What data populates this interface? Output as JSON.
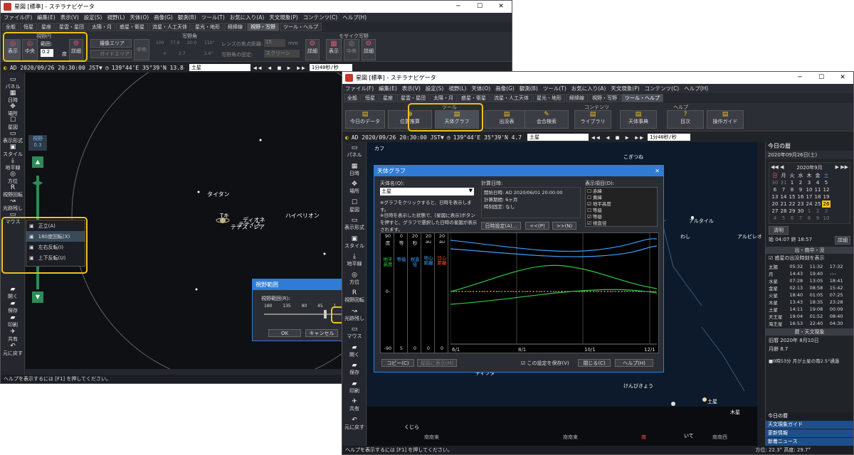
{
  "w1": {
    "title": "星図 [標準] - ステラナビゲータ",
    "menu": [
      "ファイル(F)",
      "編集(E)",
      "表示(V)",
      "設定(S)",
      "視野(L)",
      "天体(O)",
      "画像(G)",
      "観測(B)",
      "ツール(T)",
      "お気に入り(A)",
      "天文現象(P)",
      "コンテンツ(C)",
      "ヘルプ(H)"
    ],
    "tabs": [
      "全般",
      "恒星",
      "星座",
      "星雲・星団",
      "太陽・月",
      "惑星・衛星",
      "流星・人工天体",
      "星光・地形",
      "経緯線",
      "視野・写野",
      "ツール・ヘルプ"
    ],
    "grp_fov": "視野円",
    "grp_cam": "写野角",
    "grp_mosaic": "モザイク写野",
    "fov_show": "表示",
    "fov_center": "中央",
    "fov_range": "範囲:",
    "fov_value": "0.2",
    "fov_unit": "度",
    "fov_detail": "詳細",
    "cam_area": "撮像エリア",
    "cam_guide": "ガイドエリア",
    "cam_center": "中央",
    "cam_w": "100",
    "cam_h": "77.8",
    "cam_rot": "20.0",
    "cam_x": "×",
    "cam_h2": "2.7",
    "cam_deg": "110°",
    "cam_scale": "2.6°",
    "cam_rotlabel": "回転角",
    "cam_focus": "レンズの焦点距離:",
    "cam_focus_val": "15",
    "cam_mm": "mm",
    "cam_fix": "写野角の固定:",
    "cam_screen": "スクリーン",
    "cam_detail": "詳細",
    "mos_show": "表示",
    "mos_center": "中央",
    "mos_detail": "詳細",
    "status": "AD 2020/09/26 20:30:00 JST▼",
    "loc": "139°44'E 35°39'N 13.8",
    "target": "土星",
    "speed": "1分40秒/秒",
    "side": [
      "パネル",
      "日時",
      "場所",
      "星図",
      "表示形式",
      "スタイル",
      "地平線",
      "方位",
      "視野回転",
      "光跡残し",
      "マウス"
    ],
    "slider_label": "視野",
    "slider_val": "0.3",
    "planets": [
      "タイタン",
      "テティス",
      "ディオネ",
      "テチス・レア",
      "ハイペリオン",
      "Tキ"
    ],
    "rot_menu": [
      "正立(A)",
      "180度回転(X)",
      "左右反転(I)",
      "上下反転(U)"
    ],
    "fovdlg_title": "視野範囲",
    "fovdlg_label": "視野範囲(R):",
    "fovdlg_ticks": [
      "180",
      "135",
      "90",
      "45",
      "1",
      "0"
    ],
    "fovdlg_ok": "OK",
    "fovdlg_cancel": "キャンセル",
    "helptext": "ヘルプを表示するには [F1] を押してください。",
    "side_lower": [
      "開く",
      "保存",
      "印刷",
      "共有",
      "元に戻す"
    ]
  },
  "w2": {
    "title": "星図 [標準] - ステラナビゲータ",
    "menu": [
      "ファイル(F)",
      "編集(E)",
      "表示(V)",
      "設定(S)",
      "視野(L)",
      "天体(O)",
      "画像(G)",
      "観測(B)",
      "ツール(T)",
      "お気に入り(A)",
      "天文現象(P)",
      "コンテンツ(C)",
      "ヘルプ(H)"
    ],
    "tabs": [
      "全般",
      "恒星",
      "星座",
      "星雲・星団",
      "太陽・月",
      "惑星・衛星",
      "流星・人工天体",
      "星光・地形",
      "経緯線",
      "視野・写野",
      "ツール・ヘルプ"
    ],
    "grp_tool": "ツール",
    "grp_content": "コンテンツ",
    "grp_help": "ヘルプ",
    "buttons": [
      "今日のデータ",
      "位置推算",
      "天体グラフ",
      "出没表",
      "会合検索",
      "ライブラリ",
      "天体事典",
      "目次",
      "操作ガイド"
    ],
    "status": "AD 2020/09/26 20:30:00 JST▼",
    "loc": "139°44'E 35°39'N 4.7",
    "target": "土星",
    "speed": "1分40秒/秒",
    "side": [
      "パネル",
      "日時",
      "場所",
      "星図",
      "表示形式",
      "スタイル",
      "地平線",
      "方位",
      "視野回転",
      "光跡残し",
      "マウス",
      "開く",
      "保存",
      "印刷",
      "共有",
      "元に戻す"
    ],
    "sky_labels": [
      "カフ",
      "こぎつね",
      "アルタイル",
      "わし",
      "アルビレオ",
      "土星",
      "木星",
      "ディフダ",
      "いて",
      "けんびきょう",
      "くじら"
    ],
    "horizon": [
      "南南東",
      "南南東",
      "南",
      "南南西"
    ],
    "helptext": "ヘルプを表示するには [F1] を押してください。",
    "coords": "方位: 22.3° 高度: 29.7°"
  },
  "graph": {
    "title": "天体グラフ",
    "objlabel": "天体名(Q):",
    "objval": "土星",
    "note1": "※グラフをクリックすると、日時を表示します。",
    "note2": "※日時を表示した状態で、[星図に表示]ボタンを押すと、グラフで選択した日時の星図が表示されます。",
    "calc": "計算日時:",
    "start_l": "開始日時:",
    "start_v": "AD 2020/06/01 20:00:00",
    "period_l": "計算期間:",
    "period_v": "6ヶ月",
    "fix_l": "時刻固定:",
    "fix_v": "なし",
    "items_l": "表示項目(D):",
    "items": [
      {
        "t": "赤緯",
        "c": false
      },
      {
        "t": "黄緯",
        "c": false
      },
      {
        "t": "地平高度",
        "c": true
      },
      {
        "t": "等級",
        "c": false
      },
      {
        "t": "等級",
        "c": true
      },
      {
        "t": "視直径",
        "c": true
      }
    ],
    "btn_setdate": "日時設定(A)...",
    "btn_prev": "<<(P)",
    "btn_next": ">>(N)",
    "axes": [
      {
        "top": "90",
        "unit": "度",
        "bot": "-90",
        "name": "地平高度",
        "color": "#2ecc40"
      },
      {
        "top": "0",
        "unit": "等",
        "bot": "5",
        "name": "等級",
        "color": "#3aa0ff"
      },
      {
        "top": "20",
        "unit": "秒",
        "bot": "0",
        "name": "視直径",
        "color": "#3aa0ff"
      },
      {
        "top": "20",
        "unit": "au",
        "bot": "0",
        "name": "地心距離",
        "color": "#3aa0ff"
      },
      {
        "top": "20",
        "unit": "au",
        "bot": "0",
        "name": "日心距離",
        "color": "#ff5030"
      }
    ],
    "mid": "0-",
    "xlabels": [
      "6/1",
      "8/1",
      "10/1",
      "12/1"
    ],
    "btn_copy": "コピー(C)",
    "btn_map": "星図に表示(M)",
    "save_lbl": "この設定を保存(V)",
    "btn_close": "閉じる(C)",
    "btn_help": "ヘルプ(H)"
  },
  "panel": {
    "title": "今日の暦",
    "date": "2020年09月26日(土)",
    "month": "2020年9月",
    "weekdays": [
      "日",
      "月",
      "火",
      "水",
      "木",
      "金",
      "土"
    ],
    "days": [
      [
        "30",
        "31",
        "1",
        "2",
        "3",
        "4",
        "5"
      ],
      [
        "6",
        "7",
        "8",
        "9",
        "10",
        "11",
        "12"
      ],
      [
        "13",
        "14",
        "15",
        "16",
        "17",
        "18",
        "19"
      ],
      [
        "20",
        "21",
        "22",
        "23",
        "24",
        "25",
        "26"
      ],
      [
        "27",
        "28",
        "29",
        "30",
        "1",
        "2",
        "3"
      ],
      [
        "4",
        "5",
        "6",
        "7",
        "8",
        "9",
        "10"
      ]
    ],
    "sekki": "清明",
    "sun": "始 04:07 終 18:57",
    "detail": "詳細",
    "rise_title": "出・南中・没",
    "rise_chk": "惑星の出没時刻を表示",
    "rows": [
      [
        "太陽",
        "05:32",
        "11:32",
        "17:32"
      ],
      [
        "月",
        "14:43",
        "19:40",
        "-:--"
      ],
      [
        "水星",
        "07:28",
        "13:05",
        "18:41"
      ],
      [
        "金星",
        "02:13",
        "08:58",
        "15:42"
      ],
      [
        "火星",
        "18:40",
        "01:05",
        "07:25"
      ],
      [
        "木星",
        "13:43",
        "18:35",
        "23:28"
      ],
      [
        "土星",
        "14:11",
        "19:08",
        "00:09"
      ],
      [
        "天王星",
        "19:04",
        "01:52",
        "08:40"
      ],
      [
        "海王星",
        "16:53",
        "22:40",
        "04:30"
      ]
    ],
    "koyomi_title": "暦・天文現象",
    "lunar": "旧暦 2020年 8月10日",
    "moonage": "月齢 8.7",
    "event": "■0時53分 月が土星の南2.5°通過",
    "tabs": [
      "今日の暦",
      "天文現象ガイド",
      "更新情報",
      "新着ニュース"
    ]
  }
}
